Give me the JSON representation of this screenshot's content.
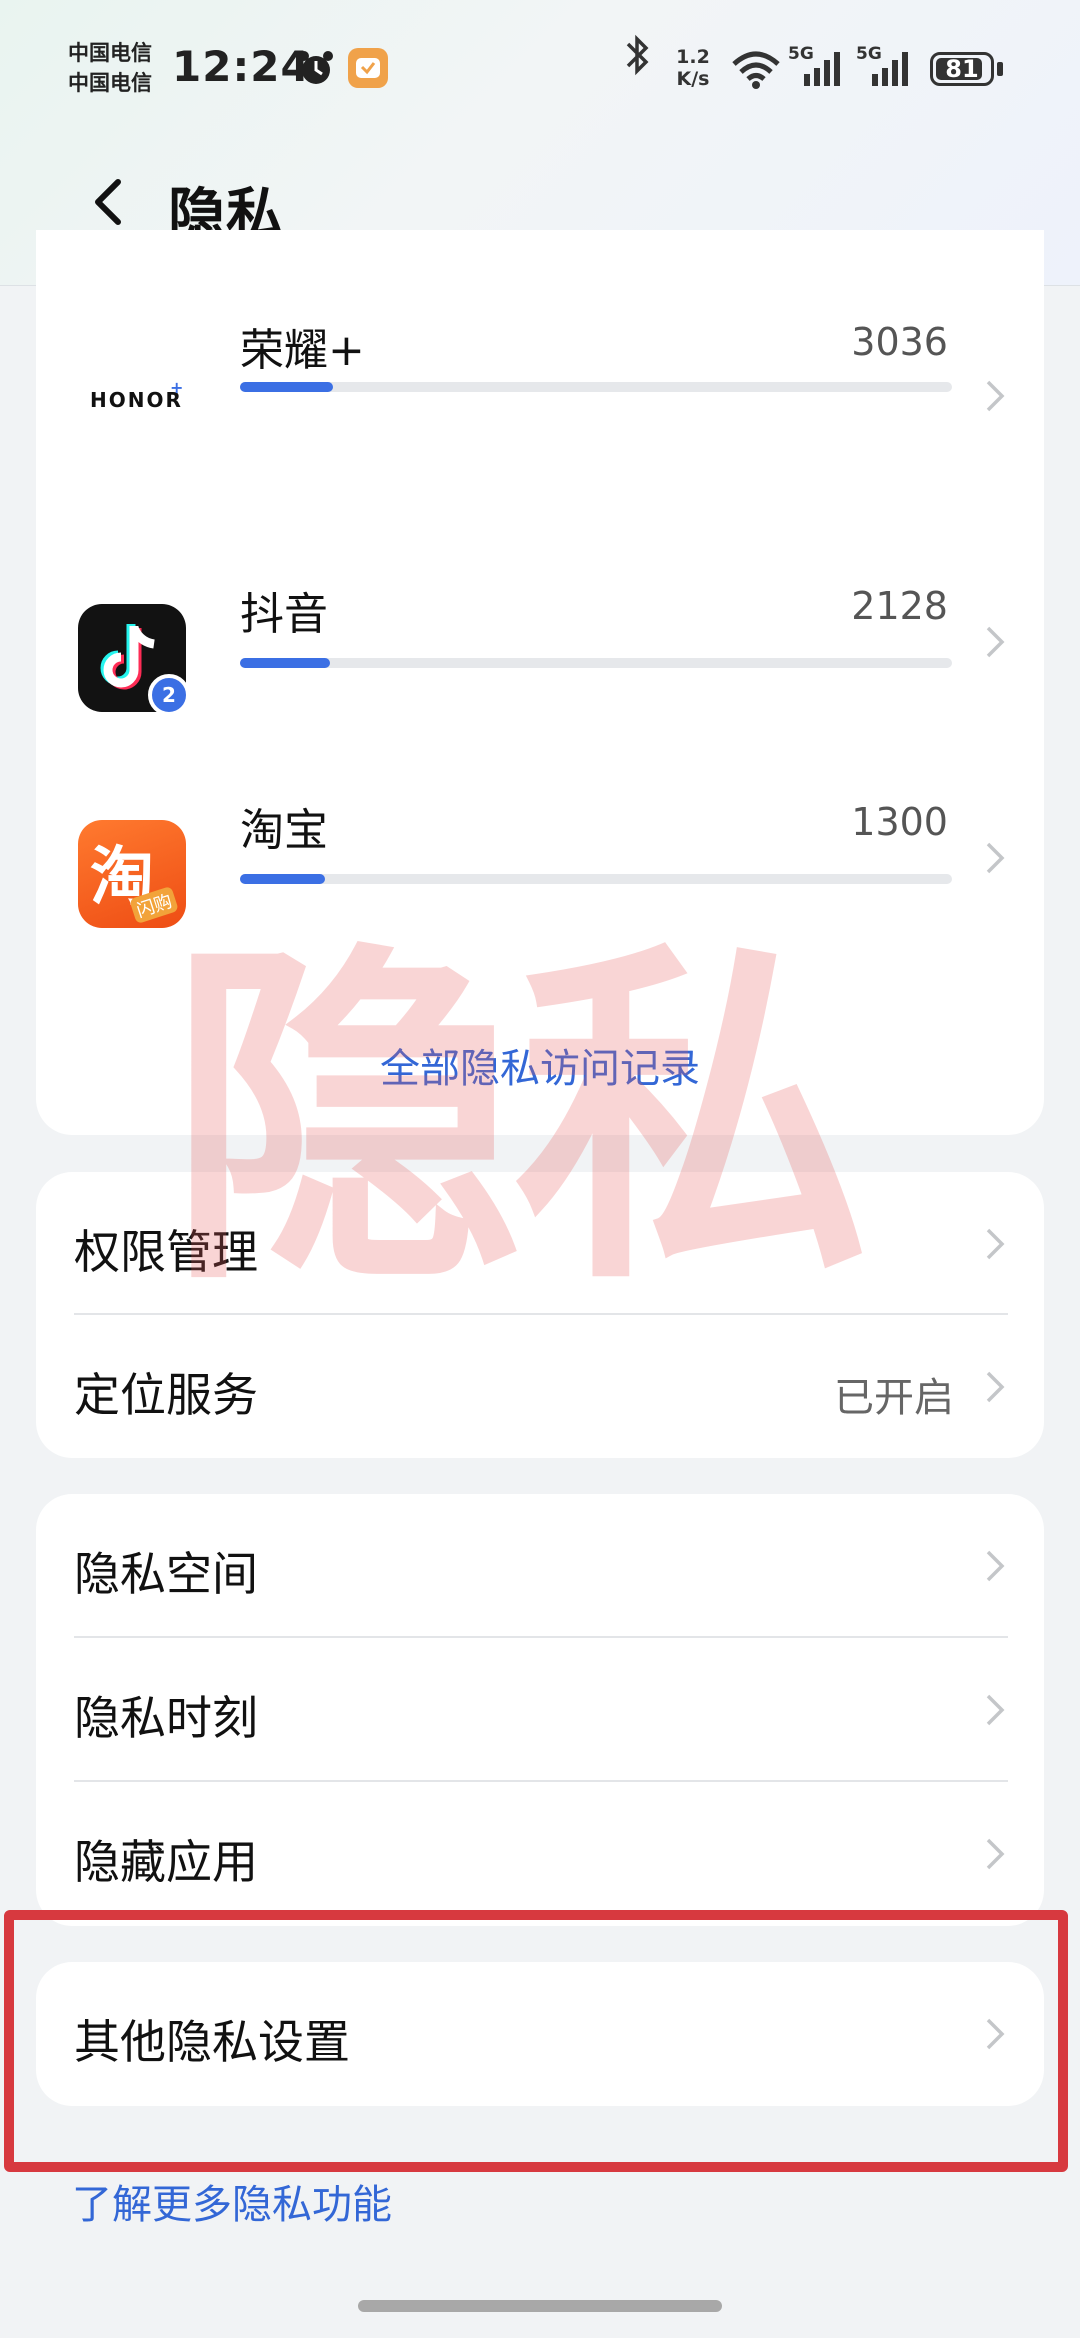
{
  "status_bar": {
    "carrier1": "中国电信",
    "carrier2": "中国电信",
    "time": "12:24",
    "net_speed_value": "1.2",
    "net_speed_unit": "K/s",
    "signal1_label": "5G",
    "signal2_label": "5G",
    "battery": "81",
    "icons": [
      "alarm-icon",
      "app-notification-icon",
      "bluetooth-icon",
      "wifi-icon",
      "signal-icon",
      "signal-icon",
      "battery-icon"
    ]
  },
  "header": {
    "title": "隐私",
    "back_icon": "chevron-left-icon"
  },
  "access_records": {
    "apps": [
      {
        "name": "荣耀+",
        "count": "3036",
        "usage_fraction": 0.13,
        "icon": "honor-logo",
        "logo_text": "HONOR"
      },
      {
        "name": "抖音",
        "count": "2128",
        "usage_fraction": 0.127,
        "icon": "douyin-icon",
        "badge": "2"
      },
      {
        "name": "淘宝",
        "count": "1300",
        "usage_fraction": 0.12,
        "icon": "taobao-icon",
        "icon_text": "淘",
        "icon_subtext": "闪购"
      }
    ],
    "view_all_label": "全部隐私访问记录"
  },
  "permissions_section": [
    {
      "label": "权限管理",
      "value": ""
    },
    {
      "label": "定位服务",
      "value": "已开启"
    }
  ],
  "space_section": [
    {
      "label": "隐私空间"
    },
    {
      "label": "隐私时刻"
    },
    {
      "label": "隐藏应用"
    }
  ],
  "other_section": {
    "label": "其他隐私设置"
  },
  "learn_more": "了解更多隐私功能",
  "watermark": "隐私",
  "colors": {
    "accent": "#3b6fe4",
    "link": "#3367d6",
    "highlight": "#d7393f",
    "watermark": "#e85c5c"
  }
}
